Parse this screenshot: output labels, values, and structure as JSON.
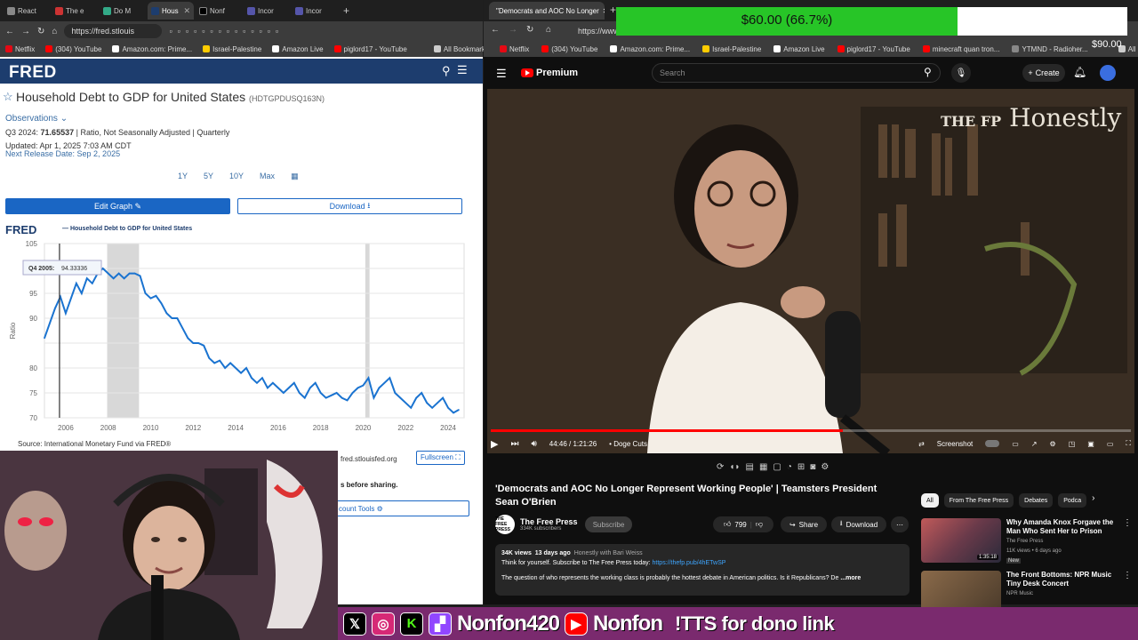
{
  "left_browser": {
    "tabs": [
      "React",
      "The e",
      "Do M",
      "Hous",
      "Nonf",
      "Incor",
      "Incor"
    ],
    "url": "https://fred.stlouis",
    "bookmarks": [
      "Netflix",
      "(304) YouTube",
      "Amazon.com: Prime...",
      "Israel-Palestine",
      "Amazon Live",
      "piglord17 - YouTube",
      "All Bookmarks"
    ]
  },
  "fred": {
    "logo": "FRED",
    "title": "Household Debt to GDP for United States",
    "series_id": "(HDTGPDUSQ163N)",
    "observations_label": "Observations",
    "latest_period": "Q3 2024:",
    "latest_value": "71.65537",
    "latest_units": "| Ratio, Not Seasonally Adjusted | Quarterly",
    "updated": "Updated: Apr 1, 2025 7:03 AM CDT",
    "next_release": "Next Release Date: Sep 2, 2025",
    "ranges": [
      "1Y",
      "5Y",
      "10Y",
      "Max"
    ],
    "edit_graph": "Edit Graph",
    "download": "Download",
    "chart_logo": "FRED",
    "legend": "Household Debt to GDP for United States",
    "source": "Source: International Monetary Fund via FRED®",
    "fullscreen": "Fullscreen",
    "fred_org": "fred.stlouisfed.org",
    "share_text": "s before sharing.",
    "account_tools": "count Tools"
  },
  "chart_data": {
    "type": "line",
    "ylabel": "Ratio",
    "ylim": [
      70,
      105
    ],
    "yticks": [
      70,
      75,
      80,
      85,
      90,
      95,
      100,
      105
    ],
    "ytick_labels": [
      "70",
      "75",
      "80",
      "",
      "90",
      "95",
      "",
      "105"
    ],
    "xlim": [
      2005.0,
      2024.75
    ],
    "xticks": [
      2006,
      2008,
      2010,
      2012,
      2014,
      2016,
      2018,
      2020,
      2022,
      2024
    ],
    "recessions": [
      [
        2007.95,
        2009.45
      ],
      [
        2020.1,
        2020.3
      ]
    ],
    "tooltip": {
      "label": "Q4 2005:",
      "value": "94.33336",
      "x": 2005.75
    },
    "series": [
      {
        "x": [
          2005.0,
          2005.25,
          2005.5,
          2005.75,
          2006.0,
          2006.25,
          2006.5,
          2006.75,
          2007.0,
          2007.25,
          2007.5,
          2007.75,
          2008.0,
          2008.25,
          2008.5,
          2008.75,
          2009.0,
          2009.25,
          2009.5,
          2009.75,
          2010.0,
          2010.25,
          2010.5,
          2010.75,
          2011.0,
          2011.25,
          2011.5,
          2011.75,
          2012.0,
          2012.25,
          2012.5,
          2012.75,
          2013.0,
          2013.25,
          2013.5,
          2013.75,
          2014.0,
          2014.25,
          2014.5,
          2014.75,
          2015.0,
          2015.25,
          2015.5,
          2015.75,
          2016.0,
          2016.25,
          2016.5,
          2016.75,
          2017.0,
          2017.25,
          2017.5,
          2017.75,
          2018.0,
          2018.25,
          2018.5,
          2018.75,
          2019.0,
          2019.25,
          2019.5,
          2019.75,
          2020.0,
          2020.25,
          2020.5,
          2020.75,
          2021.0,
          2021.25,
          2021.5,
          2021.75,
          2022.0,
          2022.25,
          2022.5,
          2022.75,
          2023.0,
          2023.25,
          2023.5,
          2023.75,
          2024.0,
          2024.25,
          2024.5
        ],
        "values": [
          86,
          89,
          92,
          94.3,
          91,
          94,
          97,
          95,
          98,
          97,
          99,
          100,
          99,
          98,
          99,
          98,
          99,
          99,
          98.5,
          95,
          94,
          94.5,
          93,
          91,
          90,
          90,
          88,
          86,
          85,
          85,
          84.5,
          82,
          81,
          81.5,
          80,
          81,
          80,
          79,
          80,
          78,
          77,
          78,
          76,
          77,
          76,
          75,
          76,
          77,
          75,
          74,
          76,
          77,
          75,
          74,
          74.5,
          75,
          74,
          73.5,
          75,
          76,
          76.5,
          78,
          74,
          76,
          77,
          78,
          75,
          74,
          73,
          72,
          74,
          75,
          73,
          72,
          73,
          74,
          72,
          71,
          71.6
        ]
      }
    ]
  },
  "right_browser": {
    "tab_title": "\"Democrats and AOC No Longer",
    "url": "https://www",
    "bookmarks": [
      "Netflix",
      "(304) YouTube",
      "Amazon.com: Prime...",
      "Israel-Palestine",
      "Amazon Live",
      "piglord17 - YouTube",
      "minecraft quan tron...",
      "YTMND - Radioher...",
      "All Bookmarks"
    ]
  },
  "youtube": {
    "brand": "Premium",
    "search_placeholder": "Search",
    "create": "Create",
    "watermark": "Honestly",
    "watermark_prefix": "THE FP",
    "time": "44:46 / 1:21:26",
    "chapter": "• Doge Cuts",
    "screenshot_label": "Screenshot",
    "progress": 0.55,
    "title": "'Democrats and AOC No Longer Represent Working People' | Teamsters President Sean O'Brien",
    "channel": "The Free Press",
    "channel_avatar": "THE FREE PRESS",
    "subscribers": "334K subscribers",
    "subscribe": "Subscribe",
    "likes": "799",
    "share": "Share",
    "download": "Download",
    "views": "34K views",
    "age": "13 days ago",
    "hashtag_line": "Honestly with Bari Weiss",
    "desc_line1": "Think for yourself. Subscribe to The Free Press today:",
    "desc_link": "https://thefp.pub/4hETwSP",
    "desc_line2": "The question of who represents the working class is probably the hottest debate in American politics. Is it Republicans? De",
    "more": "...more",
    "chips": [
      "All",
      "From The Free Press",
      "Debates",
      "Podca"
    ],
    "recs": [
      {
        "title": "Why Amanda Knox Forgave the Man Who Sent Her to Prison",
        "channel": "The Free Press",
        "meta": "11K views • 6 days ago",
        "badge": "New",
        "duration": "1:35:18"
      },
      {
        "title": "The Front Bottoms: NPR Music Tiny Desk Concert",
        "channel": "NPR Music",
        "meta": "",
        "badge": "",
        "duration": ""
      }
    ]
  },
  "donation": {
    "label": "$60.00 (66.7%)",
    "goal": "$90.00",
    "fraction": 0.667
  },
  "overlay": {
    "handle1": "Nonfon420",
    "handle2": "Nonfon",
    "tts": "!TTS for dono link"
  },
  "colors": {
    "fred_navy": "#1d3d6e",
    "fred_line": "#1a73d0",
    "yt_red": "#ff0000",
    "donate_green": "#27c527",
    "overlay_purple": "#7a2a6e"
  }
}
